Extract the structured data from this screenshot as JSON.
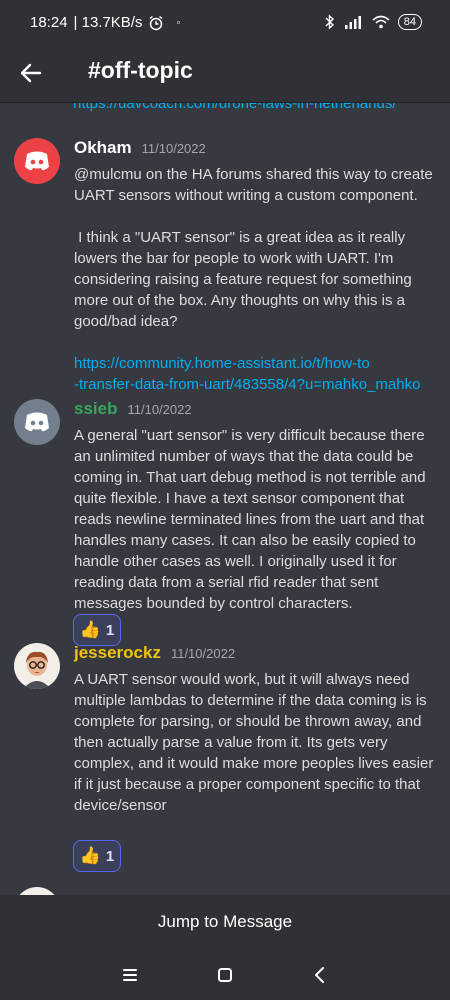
{
  "status": {
    "time": "18:24",
    "speed": "| 13.7KB/s",
    "battery": "84"
  },
  "header": {
    "channel": "#off-topic",
    "back_icon": "arrow-left-icon"
  },
  "feed": {
    "prev_link": "https://uavcoach.com/drone-laws-in-netherlands/",
    "messages": [
      {
        "author": "Okham",
        "author_color": "#ffffff",
        "time": "11/10/2022",
        "avatar": "discord-logo-red",
        "lines": [
          "@mulcmu on the HA forums shared this way to create",
          "UART sensors without writing a custom component.",
          " I think a \"UART sensor\" is a great idea as it really",
          "lowers the bar for people to work with UART. I'm",
          "considering raising a feature request for something",
          "more out of the box. Any thoughts on why this is a",
          "good/bad idea?"
        ],
        "link1": "https://community.home-assistant.io/t/how-to",
        "link2": "-transfer-data-from-uart/483558/4?u=mahko_mahko"
      },
      {
        "author": "ssieb",
        "author_color": "#3ba55c",
        "time": "11/10/2022",
        "avatar": "discord-logo-gray",
        "lines": [
          "A general \"uart sensor\" is very difficult because there",
          "an unlimited number of ways that the data could be",
          "coming in.  That uart debug method is not terrible and",
          "quite flexible.  I have a text sensor component that",
          "reads newline terminated lines from the uart and that",
          "handles many cases.  It can also be easily copied to",
          "handle other cases as well.  I originally used it for",
          "reading data from a serial rfid reader that sent",
          "messages bounded by control characters."
        ],
        "reaction": {
          "emoji": "👍",
          "count": "1"
        }
      },
      {
        "author": "jesserockz",
        "author_color": "#f1c40f",
        "time": "11/10/2022",
        "avatar": "user-photo-avatar",
        "lines": [
          "A UART sensor would work, but it will always need",
          "multiple lambdas to determine if the data coming is is",
          "complete for parsing, or should be thrown away, and",
          "then actually parse a value from it.  Its gets very",
          "complex, and it would make more peoples lives easier",
          "if it just because a proper component specific to that",
          "device/sensor"
        ],
        "reaction": {
          "emoji": "👍",
          "count": "1"
        }
      }
    ]
  },
  "jump_label": "Jump to Message",
  "navbar": {
    "recents_icon": "menu-icon",
    "home_icon": "square-icon",
    "back_icon": "triangle-back-icon"
  }
}
